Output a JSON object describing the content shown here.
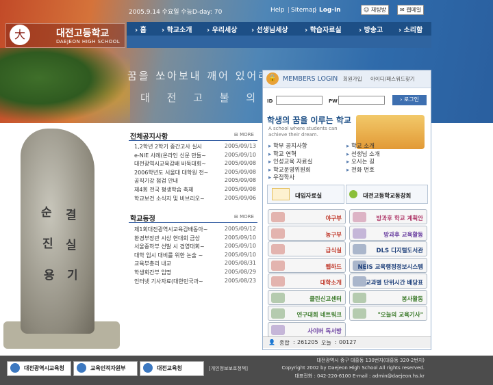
{
  "header": {
    "date_line": "2005.9.14 수요일 수능D-day: 70",
    "top_links": [
      "Help",
      "Sitemap",
      "Log-in"
    ],
    "chat_label": "채팅방",
    "webmail_label": "웹메일",
    "school_kr": "대전고등학교",
    "school_en": "DAEJEON HIGH SCHOOL",
    "emblem_char": "大"
  },
  "nav": {
    "items": [
      "홈",
      "학교소개",
      "우리세상",
      "선생님세상",
      "학습자료실",
      "방송고",
      "소리함"
    ]
  },
  "hero": {
    "poem_line1": "꿈을 쏘아보내 깨어 있어라",
    "poem_line2": "대 전 고 불 의"
  },
  "stone": {
    "chars": [
      "순",
      "결",
      "진",
      "실",
      "용",
      "기"
    ]
  },
  "notice": {
    "title": "전체공지사항",
    "more": "MORE",
    "rows": [
      {
        "title": "1,2학년 2학기 중간고사 실시",
        "date": "2005/09/13"
      },
      {
        "title": "e-NIE 사례(온라인 신문 만들~",
        "date": "2005/09/10"
      },
      {
        "title": "대전광역시교육감배 바둑대회~",
        "date": "2005/09/08"
      },
      {
        "title": "2006학년도 서울대 대학원 전~",
        "date": "2005/09/08"
      },
      {
        "title": "공직기강 점검 안내",
        "date": "2005/09/08"
      },
      {
        "title": "제4회 전국 평생학습 축제",
        "date": "2005/09/08"
      },
      {
        "title": "학교보건 소식지 및 비브리오~",
        "date": "2005/09/06"
      }
    ]
  },
  "school_news": {
    "title": "학교동정",
    "more": "MORE",
    "rows": [
      {
        "title": "제1회대전광역시교육감배동아~",
        "date": "2005/09/12"
      },
      {
        "title": "환경부장관 시상 현대회 금상",
        "date": "2005/09/10"
      },
      {
        "title": "서울중하부 선발 시 경영대회~",
        "date": "2005/09/10"
      },
      {
        "title": "대학 입시 대비를 위한 논술 ~",
        "date": "2005/09/10"
      },
      {
        "title": "교육부총리 내교",
        "date": "2005/08/31"
      },
      {
        "title": "학생회간부 임명",
        "date": "2005/08/29"
      },
      {
        "title": "인터넷 기사자료(대한민국과~",
        "date": "2005/08/23"
      }
    ]
  },
  "login": {
    "title": "MEMBERS LOGIN",
    "join": "회원가입",
    "find": "아이디/패스워드찾기",
    "id_label": "ID",
    "pw_label": "PW",
    "button": "로그인"
  },
  "banner": {
    "title": "학생의 꿈을 이루는 학교",
    "subtitle": "A school where students can achieve their dream."
  },
  "quick_links": {
    "left": [
      "학부 공지사항",
      "학교 연혁",
      "인성교육 자료실",
      "학교운영위원회",
      "우정학사"
    ],
    "right": [
      "학교 소개",
      "선생님 소개",
      "오시는 길",
      "전화 번호"
    ]
  },
  "wide_buttons": {
    "left": "대입자료실",
    "right": "대전고등학교동창회"
  },
  "tiles": [
    {
      "label": "야구부",
      "color": "#c0392b"
    },
    {
      "label": "방과후 학교 계획안",
      "color": "#b03a6a"
    },
    {
      "label": "농구부",
      "color": "#c0392b"
    },
    {
      "label": "방과후 교육활동",
      "color": "#6a3fa0"
    },
    {
      "label": "급식실",
      "color": "#c0392b"
    },
    {
      "label": "DLS 디지털도서관",
      "color": "#1d3f7a"
    },
    {
      "label": "웹하드",
      "color": "#c0392b"
    },
    {
      "label": "NEIS 교육행정정보시스템",
      "color": "#1d3f7a"
    },
    {
      "label": "대학소개",
      "color": "#c0392b"
    },
    {
      "label": "교과별 단위시간 배당표",
      "color": "#1d3f7a"
    },
    {
      "label": "클린신고센터",
      "color": "#3b7a2a"
    },
    {
      "label": "봉사활동",
      "color": "#3b7a2a"
    },
    {
      "label": "연구대회 네트워크",
      "color": "#3b7a2a"
    },
    {
      "label": "\"오늘의 교육기사\"",
      "color": "#3b7a2a"
    },
    {
      "label": "사이버 독서방",
      "color": "#6a3fa0"
    }
  ],
  "counter": {
    "total_label": "종합",
    "total": "261205",
    "today_label": "오늘",
    "today": "00127"
  },
  "footer": {
    "buttons": [
      "대전광역시교육청",
      "교육인적자원부",
      "대전교육청"
    ],
    "privacy": "[개인정보보호정책]",
    "address": "대전광역시 중구 대흥동 130번지(대흥동 320-2번지)",
    "copyright": "Copyright 2002 by Daejeon High School All rights reserved.",
    "contact": "대표전화 : 042-220-6100 E-mail : admin@daejeon.hs.kr"
  }
}
